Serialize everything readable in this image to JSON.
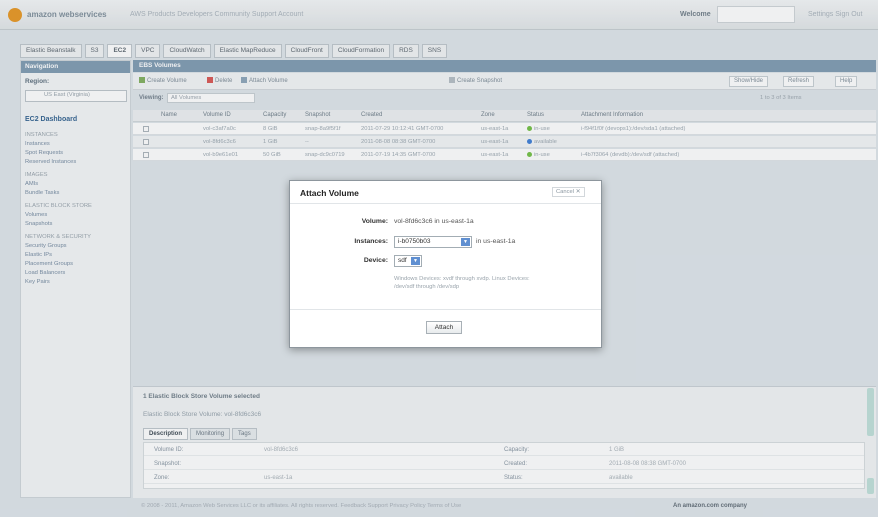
{
  "header": {
    "logo_text": "amazon webservices",
    "top_links": "AWS  Products  Developers  Community  Support  Account",
    "welcome": "Welcome",
    "right_links": "Settings  Sign Out"
  },
  "tabs": [
    {
      "label": "Elastic Beanstalk",
      "active": false
    },
    {
      "label": "S3",
      "active": false
    },
    {
      "label": "EC2",
      "active": true
    },
    {
      "label": "VPC",
      "active": false
    },
    {
      "label": "CloudWatch",
      "active": false
    },
    {
      "label": "Elastic MapReduce",
      "active": false
    },
    {
      "label": "CloudFront",
      "active": false
    },
    {
      "label": "CloudFormation",
      "active": false
    },
    {
      "label": "RDS",
      "active": false
    },
    {
      "label": "SNS",
      "active": false
    }
  ],
  "sidebar": {
    "heading": "Navigation",
    "region_label": "Region:",
    "region_value": "US East (Virginia)",
    "items": [
      {
        "label": "EC2 Dashboard",
        "type": "dash"
      },
      {
        "label": "INSTANCES",
        "type": "heading"
      },
      {
        "label": "Instances",
        "type": "item"
      },
      {
        "label": "Spot Requests",
        "type": "item"
      },
      {
        "label": "Reserved Instances",
        "type": "item"
      },
      {
        "label": "IMAGES",
        "type": "heading"
      },
      {
        "label": "AMIs",
        "type": "item"
      },
      {
        "label": "Bundle Tasks",
        "type": "item"
      },
      {
        "label": "ELASTIC BLOCK STORE",
        "type": "heading"
      },
      {
        "label": "Volumes",
        "type": "item"
      },
      {
        "label": "Snapshots",
        "type": "item"
      },
      {
        "label": "NETWORK & SECURITY",
        "type": "heading"
      },
      {
        "label": "Security Groups",
        "type": "item"
      },
      {
        "label": "Elastic IPs",
        "type": "item"
      },
      {
        "label": "Placement Groups",
        "type": "item"
      },
      {
        "label": "Load Balancers",
        "type": "item"
      },
      {
        "label": "Key Pairs",
        "type": "item"
      }
    ]
  },
  "main": {
    "heading": "EBS Volumes",
    "toolbar": {
      "create": "Create Volume",
      "delete": "Delete",
      "attach": "Attach Volume",
      "snapshot": "Create Snapshot",
      "show_hide": "Show/Hide",
      "refresh": "Refresh",
      "help": "Help"
    },
    "viewing_label": "Viewing:",
    "viewing_value": "All Volumes",
    "pager": "1 to 3 of 3 Items",
    "columns": [
      "Name",
      "Volume ID",
      "Capacity",
      "Snapshot",
      "Created",
      "Zone",
      "Status",
      "Attachment Information"
    ],
    "rows": [
      {
        "name": "",
        "volume_id": "vol-c3af7a0c",
        "capacity": "8 GiB",
        "snapshot": "snap-8a9f5f1f",
        "created": "2011-07-29 10:12:41 GMT-0700",
        "zone": "us-east-1a",
        "status": "in-use",
        "status_color": "#6fbf3f",
        "attachment": "i-f94f1f0f (devops1):/dev/sda1 (attached)"
      },
      {
        "name": "",
        "volume_id": "vol-8fd6c3c6",
        "capacity": "1 GiB",
        "snapshot": "--",
        "created": "2011-08-08 08:38 GMT-0700",
        "zone": "us-east-1a",
        "status": "available",
        "status_color": "#3a7bd5",
        "attachment": ""
      },
      {
        "name": "",
        "volume_id": "vol-b9e61e01",
        "capacity": "50 GiB",
        "snapshot": "snap-dc9c0719",
        "created": "2011-07-19 14:35 GMT-0700",
        "zone": "us-east-1a",
        "status": "in-use",
        "status_color": "#6fbf3f",
        "attachment": "i-4b7f3064 (devdb):/dev/sdf (attached)"
      }
    ]
  },
  "detail": {
    "title": "1 Elastic Block Store Volume selected",
    "subtitle": "Elastic Block Store Volume: vol-8fd6c3c6",
    "tabs": [
      "Description",
      "Monitoring",
      "Tags"
    ],
    "rows": [
      {
        "label": "Volume ID:",
        "value": "vol-8fd6c3c6",
        "label2": "Capacity:",
        "value2": "1 GiB"
      },
      {
        "label": "Snapshot:",
        "value": "",
        "label2": "Created:",
        "value2": "2011-08-08 08:38 GMT-0700"
      },
      {
        "label": "Zone:",
        "value": "us-east-1a",
        "label2": "Status:",
        "value2": "available"
      }
    ]
  },
  "footer": {
    "copyright": "© 2008 - 2011, Amazon Web Services LLC or its affiliates. All rights reserved.   Feedback   Support   Privacy Policy   Terms of Use",
    "brand": "An amazon.com company"
  },
  "modal": {
    "title": "Attach Volume",
    "cancel": "Cancel ✕",
    "volume_label": "Volume:",
    "volume_value": "vol-8fd6c3c6 in us-east-1a",
    "instances_label": "Instances:",
    "instance_value": "i-b0750b03",
    "instance_zone": "in us-east-1a",
    "device_label": "Device:",
    "device_value": "sdf",
    "hint": "Windows Devices: xvdf through xvdp. Linux Devices: /dev/sdf through /dev/sdp",
    "attach_label": "Attach"
  }
}
